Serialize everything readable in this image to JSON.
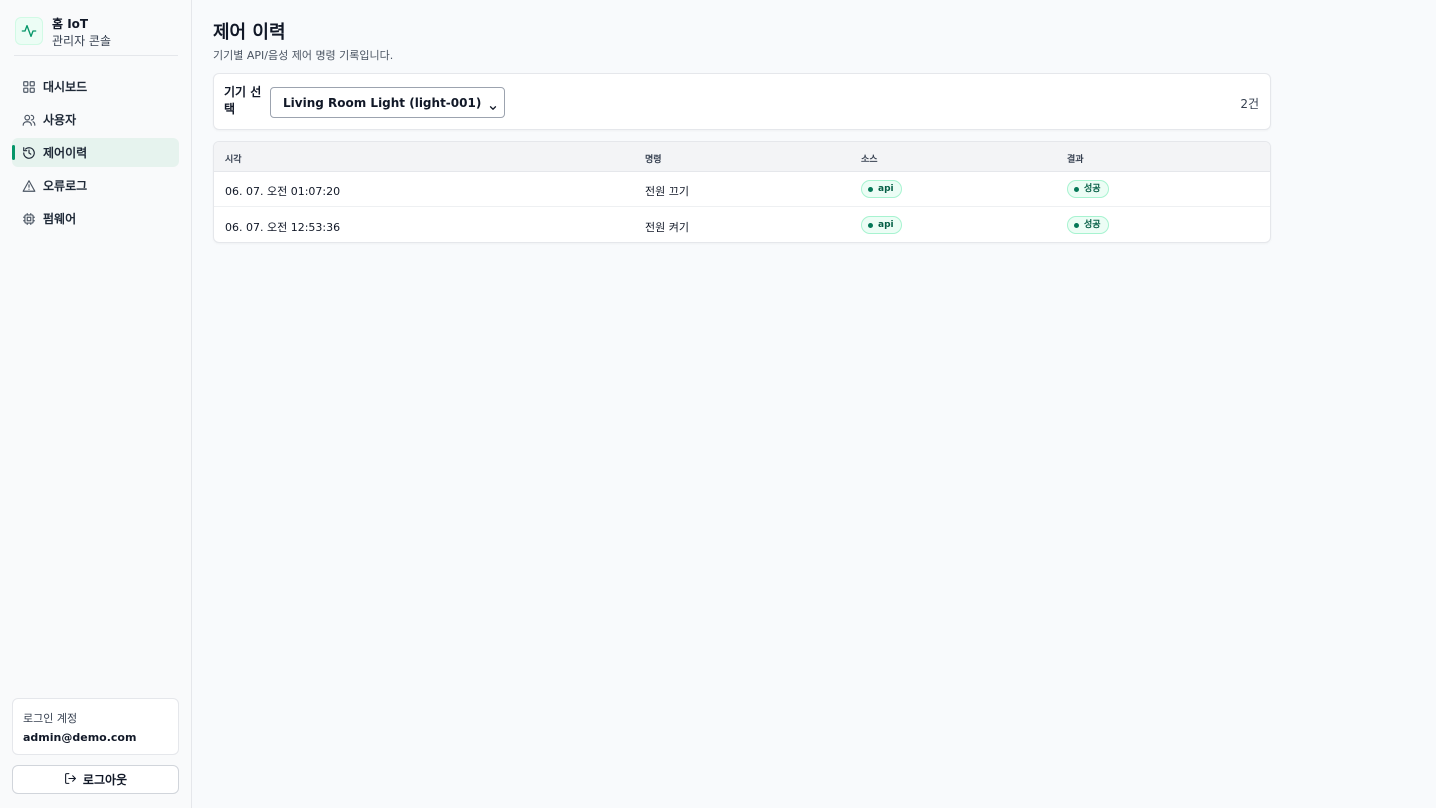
{
  "brand": {
    "title": "홈 IoT",
    "subtitle": "관리자 콘솔",
    "icon": "activity-icon"
  },
  "nav": {
    "items": [
      {
        "label": "대시보드",
        "icon": "dashboard-grid-icon"
      },
      {
        "label": "사용자",
        "icon": "users-icon"
      },
      {
        "label": "제어이력",
        "icon": "history-icon",
        "active": true
      },
      {
        "label": "오류로그",
        "icon": "warning-triangle-icon"
      },
      {
        "label": "펌웨어",
        "icon": "chip-icon"
      }
    ]
  },
  "account": {
    "label": "로그인 계정",
    "email": "admin@demo.com"
  },
  "logout": {
    "label": "로그아웃",
    "icon": "logout-icon"
  },
  "page": {
    "title": "제어 이력",
    "subtitle": "기기별 API/음성 제어 명령 기록입니다."
  },
  "filter": {
    "label": "기기 선택",
    "selected": "Living Room Light (light-001)",
    "count": "2건"
  },
  "table": {
    "headers": [
      "시각",
      "명령",
      "소스",
      "결과"
    ],
    "rows": [
      {
        "time": "06. 07. 오전 01:07:20",
        "command": "전원 끄기",
        "source": "api",
        "result": "성공"
      },
      {
        "time": "06. 07. 오전 12:53:36",
        "command": "전원 켜기",
        "source": "api",
        "result": "성공"
      }
    ]
  },
  "colors": {
    "accent": "#059669",
    "active_bg": "#e6f3ee",
    "badge_bg": "#ecfdf5",
    "badge_text": "#065f46"
  }
}
